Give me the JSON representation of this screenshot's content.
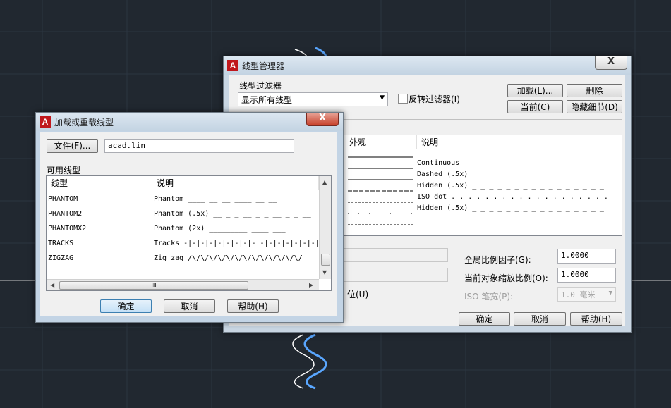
{
  "background": {
    "color": "#212830",
    "grid_color": "#2c3641"
  },
  "linetype_manager": {
    "title": "线型管理器",
    "close_label": "X",
    "filter_group_label": "线型过滤器",
    "filter_select_value": "显示所有线型",
    "invert_filter_label": "反转过滤器(I)",
    "buttons": {
      "load": "加载(L)...",
      "delete": "删除",
      "current": "当前(C)",
      "hide_details": "隐藏细节(D)",
      "ok": "确定",
      "cancel": "取消",
      "help": "帮助(H)"
    },
    "columns": {
      "appearance": "外观",
      "description": "说明"
    },
    "rows": [
      {
        "description": ""
      },
      {
        "description": ""
      },
      {
        "description": "Continuous"
      },
      {
        "description": "Dashed (.5x) ________________________"
      },
      {
        "description": "Hidden (.5x) _ _ _ _ _ _ _ _ _ _ _ _ _ _ _ _"
      },
      {
        "description": "ISO dot . . . . . . . . . . . . . . . . . . ."
      },
      {
        "description": "Hidden (.5x) _ _ _ _ _ _ _ _ _ _ _ _ _ _ _ _"
      }
    ],
    "global_scale_label": "全局比例因子(G):",
    "global_scale_value": "1.0000",
    "current_scale_label": "当前对象缩放比例(O):",
    "current_scale_value": "1.0000",
    "iso_pen_label": "ISO 笔宽(P):",
    "iso_pen_value": "1.0 毫米",
    "paper_space_fragment": "位(U)"
  },
  "load_dialog": {
    "title": "加载或重载线型",
    "close_label": "X",
    "file_button": "文件(F)...",
    "file_value": "acad.lin",
    "available_label": "可用线型",
    "columns": {
      "linetype": "线型",
      "description": "说明"
    },
    "rows": [
      {
        "name": "PHANTOM",
        "description": "Phantom ____ __ __ ____ __ __"
      },
      {
        "name": "PHANTOM2",
        "description": "Phantom (.5x) __ _ _ __ _ _ __ _ _ __"
      },
      {
        "name": "PHANTOMX2",
        "description": "Phantom (2x) _________      ____   ___"
      },
      {
        "name": "TRACKS",
        "description": "Tracks -|-|-|-|-|-|-|-|-|-|-|-|-|-|-|-|-"
      },
      {
        "name": "ZIGZAG",
        "description": "Zig zag /\\/\\/\\/\\/\\/\\/\\/\\/\\/\\/\\/\\/\\/"
      }
    ],
    "hscroll_glyph": "III",
    "buttons": {
      "ok": "确定",
      "cancel": "取消",
      "help": "帮助(H)"
    }
  }
}
